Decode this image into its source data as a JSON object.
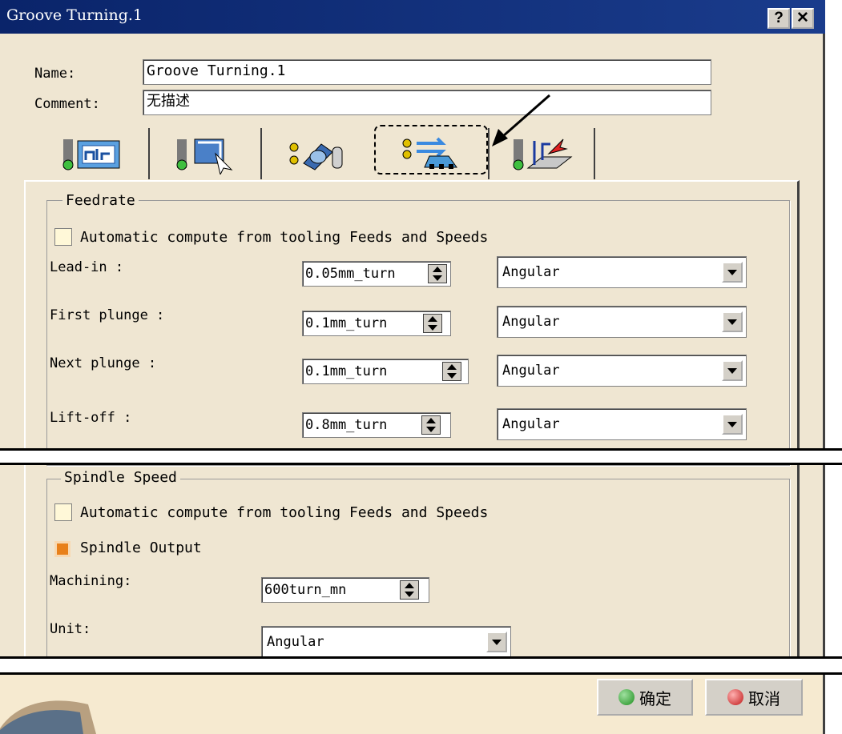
{
  "window": {
    "title": "Groove Turning.1",
    "help_label": "?",
    "close_label": "✕"
  },
  "form": {
    "name_label": "Name:",
    "name_value": "Groove Turning.1",
    "comment_label": "Comment:",
    "comment_value": "无描述"
  },
  "tabs": [
    {
      "icon": "geometry-tab-icon"
    },
    {
      "icon": "strategy-tab-icon"
    },
    {
      "icon": "tool-tab-icon"
    },
    {
      "icon": "feeds-speeds-tab-icon",
      "selected": true
    },
    {
      "icon": "macro-tab-icon"
    }
  ],
  "feedrate": {
    "legend": "Feedrate",
    "auto_compute_label": "Automatic compute from tooling Feeds and Speeds",
    "rows": [
      {
        "label": "Lead-in :",
        "value": "0.05mm_turn",
        "unit": "Angular"
      },
      {
        "label": "First plunge :",
        "value": "0.1mm_turn",
        "unit": "Angular"
      },
      {
        "label": "Next plunge :",
        "value": "0.1mm_turn",
        "unit": "Angular"
      },
      {
        "label": "Lift-off :",
        "value": "0.8mm_turn",
        "unit": "Angular"
      }
    ]
  },
  "spindle": {
    "legend": "Spindle Speed",
    "auto_compute_label": "Automatic compute from tooling Feeds and Speeds",
    "output_label": "Spindle Output",
    "machining_label": "Machining:",
    "machining_value": "600turn_mn",
    "unit_label": "Unit:",
    "unit_value": "Angular"
  },
  "buttons": {
    "ok_label": "确定",
    "cancel_label": "取消"
  },
  "colors": {
    "titlebar": "#0a246a",
    "dialog": "#efe6d2",
    "ok_dot": "#2fa02f",
    "cancel_dot": "#d02020"
  }
}
